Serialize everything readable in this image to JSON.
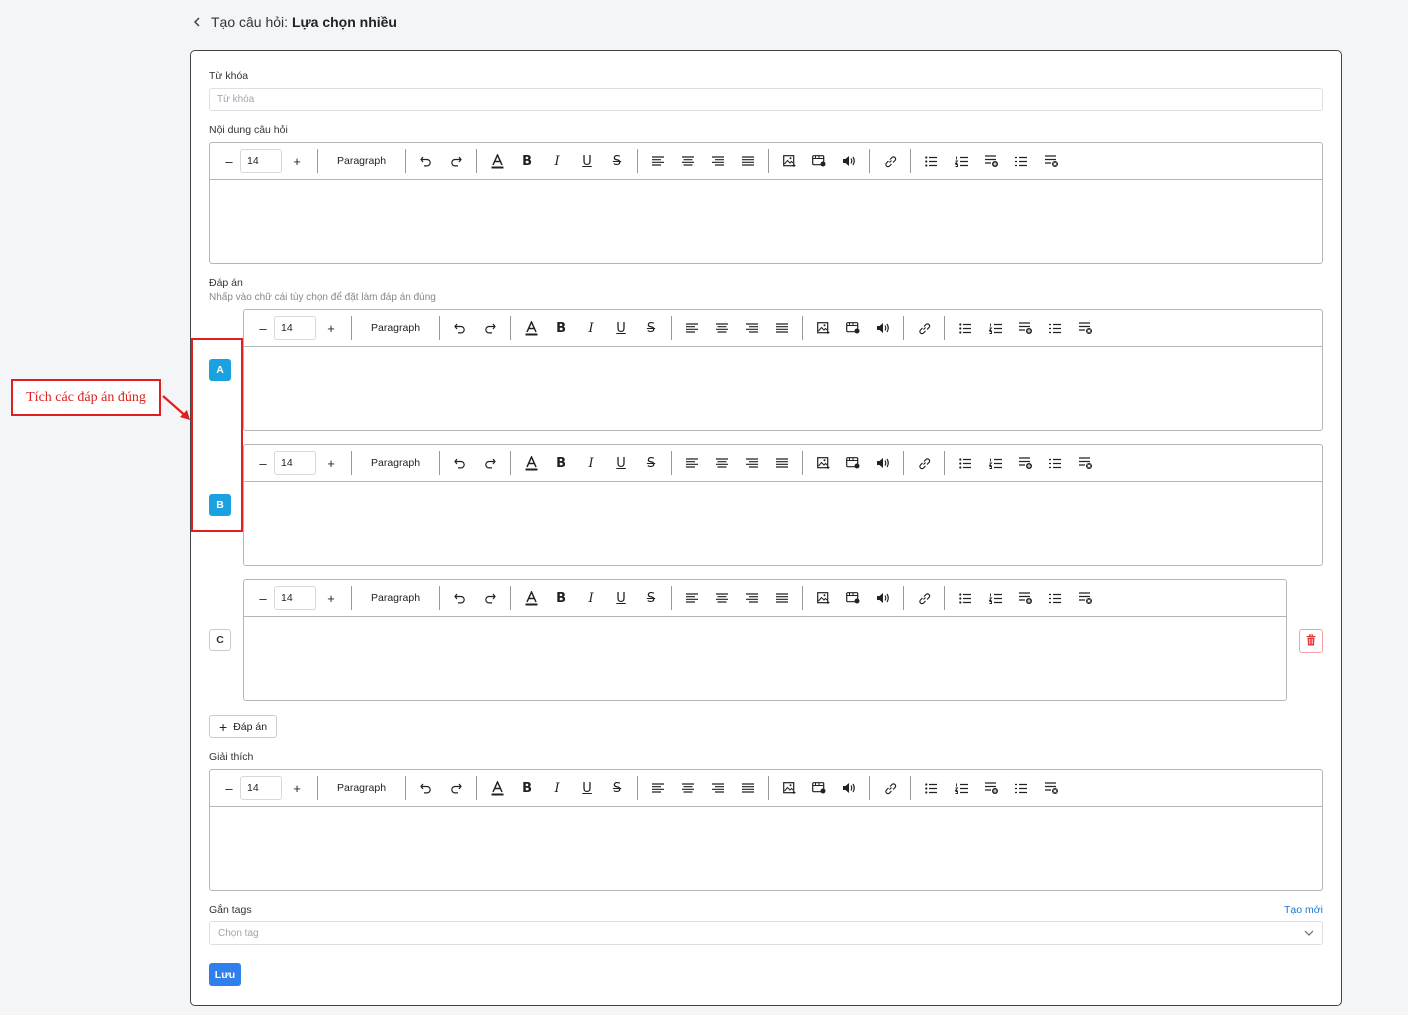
{
  "header": {
    "prefix": "Tạo câu hỏi:",
    "title": "Lựa chọn nhiều"
  },
  "keyword": {
    "label": "Từ khóa",
    "placeholder": "Từ khóa"
  },
  "question_content": {
    "label": "Nội dung câu hỏi"
  },
  "toolbar": {
    "font_size": "14",
    "paragraph": "Paragraph",
    "minus": "–",
    "plus": "+",
    "bold": "B",
    "italic": "I",
    "underline": "U",
    "strike": "S"
  },
  "answers": {
    "label": "Đáp án",
    "hint": "Nhấp vào chữ cái tùy chọn để đặt làm đáp án đúng",
    "choices": [
      {
        "letter": "A",
        "correct": true
      },
      {
        "letter": "B",
        "correct": true
      },
      {
        "letter": "C",
        "correct": false
      }
    ],
    "add_label": "Đáp án",
    "add_icon": "+"
  },
  "explanation": {
    "label": "Giải thích"
  },
  "tags": {
    "label": "Gắn tags",
    "create_link": "Tạo mới",
    "placeholder": "Chọn tag"
  },
  "save_label": "Lưu",
  "annotation": {
    "text": "Tích các đáp án đúng"
  },
  "colors": {
    "accent": "#1aa2e0",
    "save": "#2f80ed",
    "annotation": "#e02020",
    "delete": "#e5363f"
  },
  "icons": [
    "back-chevron-icon",
    "undo-icon",
    "redo-icon",
    "font-color-icon",
    "align-left-icon",
    "align-center-icon",
    "align-right-icon",
    "align-justify-icon",
    "image-icon",
    "video-icon",
    "audio-icon",
    "link-icon",
    "bullet-list-icon",
    "numbered-list-icon",
    "list-add-icon",
    "list-icon",
    "list-remove-icon",
    "trash-icon",
    "chevron-down-icon"
  ]
}
